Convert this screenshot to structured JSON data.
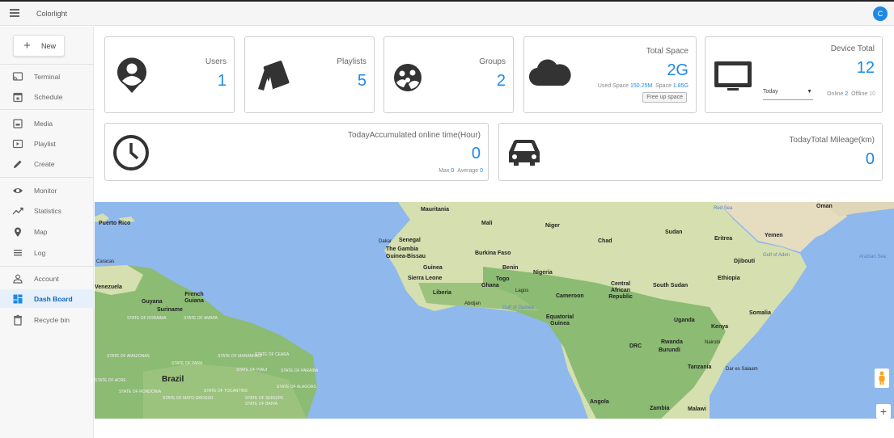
{
  "app": {
    "title": "Colorlight",
    "avatar_initial": "C"
  },
  "sidebar": {
    "new_label": "New",
    "items": [
      {
        "label": "Terminal",
        "icon": "terminal-icon"
      },
      {
        "label": "Schedule",
        "icon": "schedule-icon"
      },
      {
        "label": "Media",
        "icon": "media-icon"
      },
      {
        "label": "Playlist",
        "icon": "playlist-icon"
      },
      {
        "label": "Create",
        "icon": "pencil-icon"
      },
      {
        "label": "Monitor",
        "icon": "eye-icon"
      },
      {
        "label": "Statistics",
        "icon": "trend-icon"
      },
      {
        "label": "Map",
        "icon": "pin-icon"
      },
      {
        "label": "Log",
        "icon": "log-icon"
      },
      {
        "label": "Account",
        "icon": "person-icon"
      },
      {
        "label": "Dash Board",
        "icon": "dashboard-icon",
        "active": true
      },
      {
        "label": "Recycle bin",
        "icon": "trash-icon"
      }
    ]
  },
  "cards": {
    "users": {
      "title": "Users",
      "value": "1"
    },
    "playlists": {
      "title": "Playlists",
      "value": "5"
    },
    "groups": {
      "title": "Groups",
      "value": "2"
    },
    "total_space": {
      "title": "Total Space",
      "value": "2G",
      "used_label": "Used Space",
      "used_value": "150.25M",
      "space_label": "Space",
      "space_value": "1.85G",
      "free_button": "Free up space"
    },
    "device_total": {
      "title": "Device Total",
      "value": "12",
      "period": "Today",
      "online_label": "Online",
      "online_value": "2",
      "offline_label": "Offline",
      "offline_value": "10"
    },
    "online_time": {
      "title": "TodayAccumulated online time(Hour)",
      "value": "0",
      "max_label": "Max",
      "max_value": "0",
      "avg_label": "Average",
      "avg_value": "0"
    },
    "mileage": {
      "title": "TodayTotal Mileage(km)",
      "value": "0"
    }
  },
  "map": {
    "labels": [
      "Puerto Rico",
      "Mauritania",
      "Mali",
      "Niger",
      "Chad",
      "Sudan",
      "Eritrea",
      "Yemen",
      "Oman",
      "Dakar",
      "Senegal",
      "The Gambia",
      "Guinea-Bissau",
      "Burkina Faso",
      "Guinea",
      "Benin",
      "Nigeria",
      "Sierra Leone",
      "Togo",
      "Ghana",
      "Liberia",
      "Lagos",
      "Abidjan",
      "Cameroon",
      "Central African Republic",
      "South Sudan",
      "Djibouti",
      "Ethiopia",
      "Caracas",
      "Venezuela",
      "French Guiana",
      "Guyana",
      "Suriname",
      "Equatorial Guinea",
      "Somalia",
      "Uganda",
      "Kenya",
      "Nairobi",
      "Rwanda",
      "Burundi",
      "DRC",
      "Tanzania",
      "Dar es Salaam",
      "Brazil",
      "Angola",
      "Zambia",
      "Malawi"
    ],
    "seas": [
      "Gulf of Guinea",
      "Red Sea",
      "Gulf of Aden",
      "Arabian Sea"
    ],
    "states": [
      "STATE OF RORAIMA",
      "STATE OF AMAPA",
      "STATE OF AMAZONAS",
      "STATE OF PARA",
      "STATE OF MARANHAO",
      "STATE OF CEARA",
      "STATE OF PIAUI",
      "STATE OF PARAIBA",
      "STATE OF ALAGOAS",
      "STATE OF RONDONIA",
      "STATE OF MATO GROSSO",
      "STATE OF TOCANTINS",
      "STATE OF SERGIPE",
      "STATE OF BAHIA",
      "STATE OF ACRE"
    ]
  }
}
